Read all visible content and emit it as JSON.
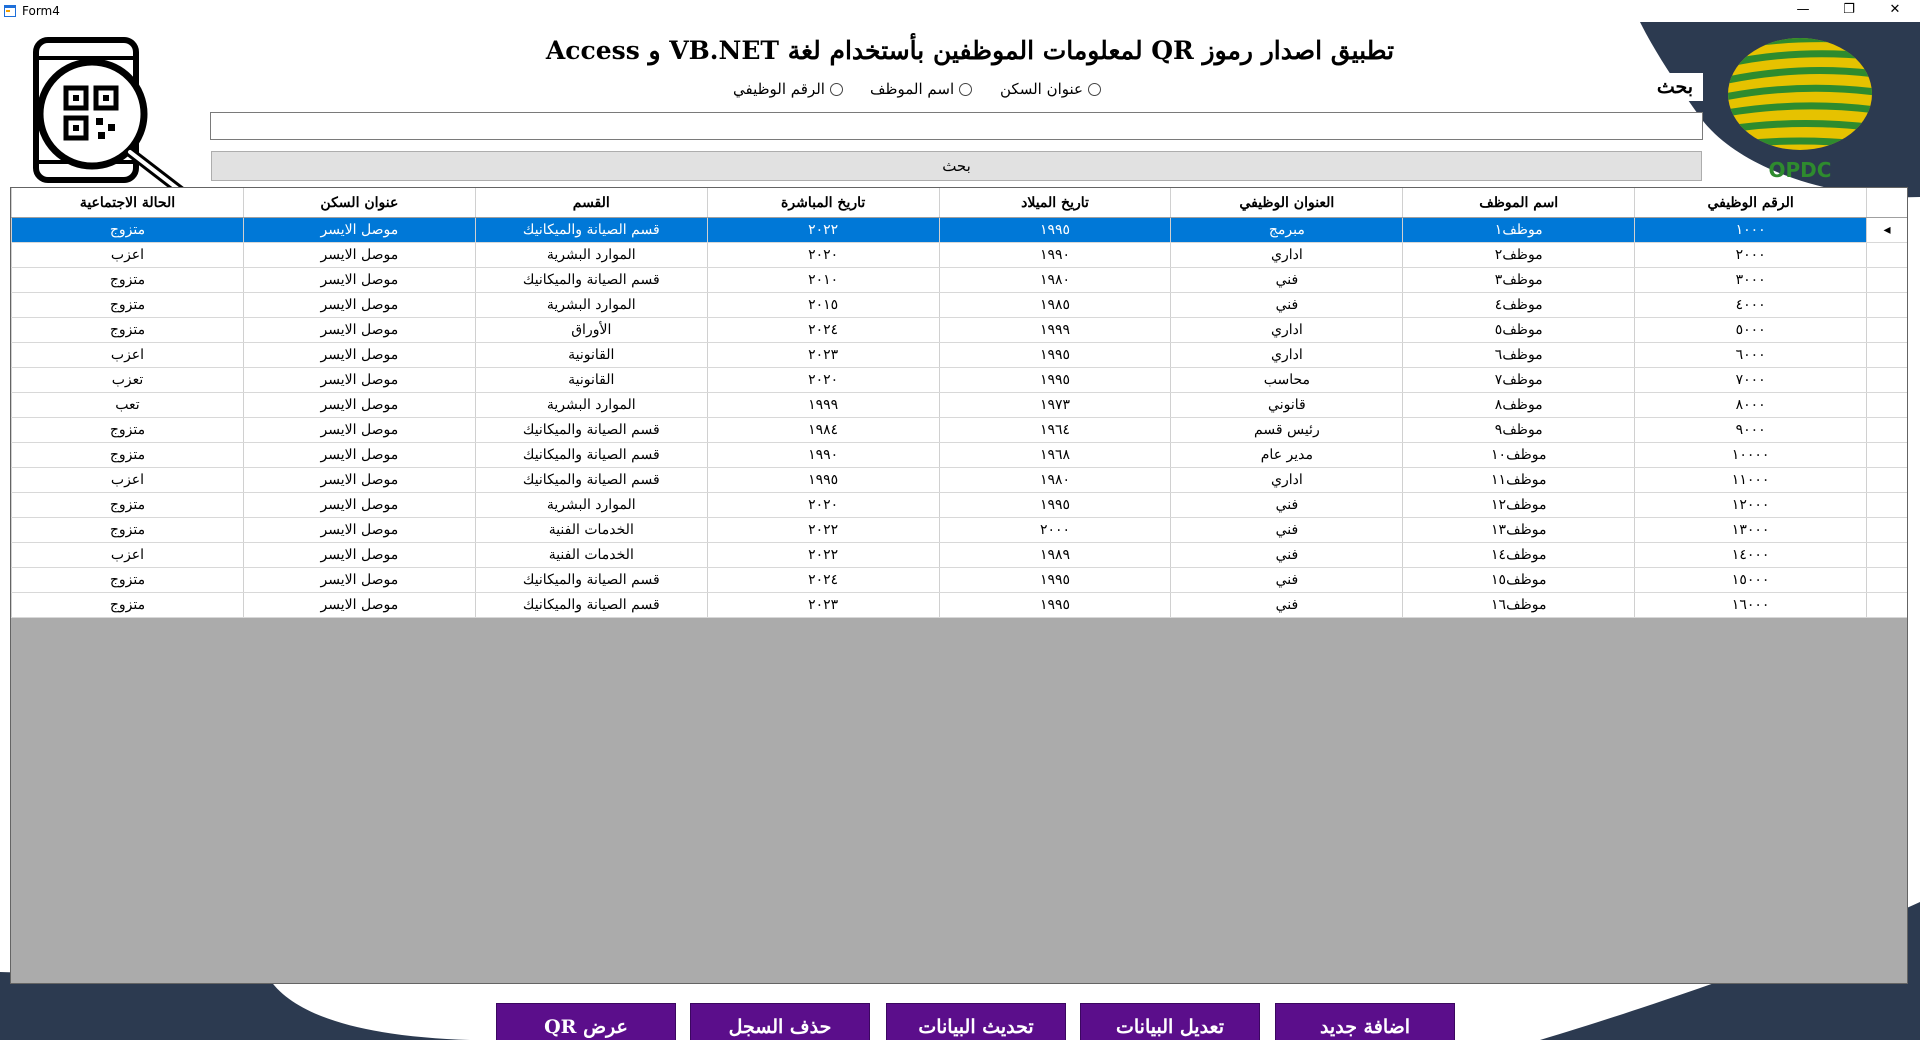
{
  "window": {
    "title": "Form4",
    "minimize_glyph": "—",
    "restore_glyph": "❐",
    "close_glyph": "✕"
  },
  "header": {
    "title": "تطبيق اصدار رموز QR لمعلومات الموظفين بأستخدام لغة VB.NET  و Access",
    "logo_text": "OPDC",
    "search_badge": "بحث"
  },
  "search": {
    "options": [
      "عنوان السكن",
      "اسم الموظف",
      "الرقم الوظيفي"
    ],
    "input_value": "",
    "button_label": "بحث"
  },
  "grid": {
    "columns": [
      "الرقم الوظيفي",
      "اسم الموظف",
      "العنوان الوظيفي",
      "تاريخ الميلاد",
      "تاريخ المباشرة",
      "القسم",
      "عنوان السكن",
      "الحالة الاجتماعية"
    ],
    "selected_row": 0,
    "row_pointer": "◂",
    "rows": [
      [
        "١٠٠٠",
        "موظف١",
        "مبرمج",
        "١٩٩٥",
        "٢٠٢٢",
        "قسم الصيانة والميكانيك",
        "موصل الايسر",
        "متزوج"
      ],
      [
        "٢٠٠٠",
        "موظف٢",
        "اداري",
        "١٩٩٠",
        "٢٠٢٠",
        "الموارد البشرية",
        "موصل الايسر",
        "اعزب"
      ],
      [
        "٣٠٠٠",
        "موظف٣",
        "فني",
        "١٩٨٠",
        "٢٠١٠",
        "قسم الصيانة والميكانيك",
        "موصل الايسر",
        "متزوج"
      ],
      [
        "٤٠٠٠",
        "موظف٤",
        "فني",
        "١٩٨٥",
        "٢٠١٥",
        "الموارد البشرية",
        "موصل الايسر",
        "متزوج"
      ],
      [
        "٥٠٠٠",
        "موظف٥",
        "اداري",
        "١٩٩٩",
        "٢٠٢٤",
        "الأوراق",
        "موصل الايسر",
        "متزوج"
      ],
      [
        "٦٠٠٠",
        "موظف٦",
        "اداري",
        "١٩٩٥",
        "٢٠٢٣",
        "القانونية",
        "موصل الايسر",
        "اعزب"
      ],
      [
        "٧٠٠٠",
        "موظف٧",
        "محاسب",
        "١٩٩٥",
        "٢٠٢٠",
        "القانونية",
        "موصل الايسر",
        "تعزب"
      ],
      [
        "٨٠٠٠",
        "موظف٨",
        "قانوني",
        "١٩٧٣",
        "١٩٩٩",
        "الموارد البشرية",
        "موصل الايسر",
        "تعب"
      ],
      [
        "٩٠٠٠",
        "موظف٩",
        "رئيس قسم",
        "١٩٦٤",
        "١٩٨٤",
        "قسم الصيانة والميكانيك",
        "موصل الايسر",
        "متزوج"
      ],
      [
        "١٠٠٠٠",
        "موظف١٠",
        "مدير عام",
        "١٩٦٨",
        "١٩٩٠",
        "قسم الصيانة والميكانيك",
        "موصل الايسر",
        "متزوج"
      ],
      [
        "١١٠٠٠",
        "موظف١١",
        "اداري",
        "١٩٨٠",
        "١٩٩٥",
        "قسم الصيانة والميكانيك",
        "موصل الايسر",
        "اعزب"
      ],
      [
        "١٢٠٠٠",
        "موظف١٢",
        "فني",
        "١٩٩٥",
        "٢٠٢٠",
        "الموارد البشرية",
        "موصل الايسر",
        "متزوج"
      ],
      [
        "١٣٠٠٠",
        "موظف١٣",
        "فني",
        "٢٠٠٠",
        "٢٠٢٢",
        "الخدمات الفنية",
        "موصل الايسر",
        "متزوج"
      ],
      [
        "١٤٠٠٠",
        "موظف١٤",
        "فني",
        "١٩٨٩",
        "٢٠٢٢",
        "الخدمات الفنية",
        "موصل الايسر",
        "اعزب"
      ],
      [
        "١٥٠٠٠",
        "موظف١٥",
        "فني",
        "١٩٩٥",
        "٢٠٢٤",
        "قسم الصيانة والميكانيك",
        "موصل الايسر",
        "متزوج"
      ],
      [
        "١٦٠٠٠",
        "موظف١٦",
        "فني",
        "١٩٩٥",
        "٢٠٢٣",
        "قسم الصيانة والميكانيك",
        "موصل الايسر",
        "متزوج"
      ]
    ]
  },
  "actions": {
    "add": "اضافة جديد",
    "edit": "تعديل البيانات",
    "refresh": "تحديث البيانات",
    "delete": "حذف السجل",
    "show_qr": "عرض QR"
  },
  "colors": {
    "accent_purple": "#5b0e8b",
    "navy_curve": "#2c3a50",
    "selection_blue": "#0078d7",
    "grid_background": "#ababab",
    "logo_green": "#2e8b2e",
    "logo_yellow": "#e6c200"
  },
  "icons": {
    "app": "form-window-icon",
    "qr_search": "qr-phone-magnifier-icon",
    "logo": "opdc-striped-globe-logo"
  }
}
